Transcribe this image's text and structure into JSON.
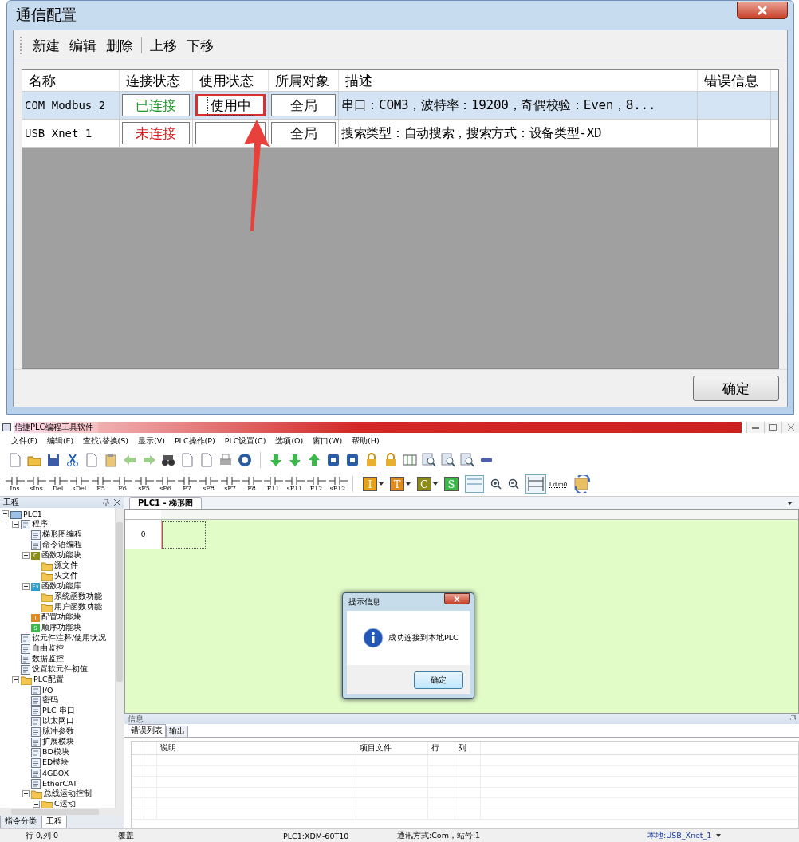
{
  "config_dialog": {
    "title": "通信配置",
    "toolbar": [
      {
        "label": "新建",
        "separator_before": false
      },
      {
        "label": "编辑",
        "separator_before": false
      },
      {
        "label": "删除",
        "separator_before": false
      },
      {
        "label": "上移",
        "separator_before": true
      },
      {
        "label": "下移",
        "separator_before": false
      }
    ],
    "columns": [
      "名称",
      "连接状态",
      "使用状态",
      "所属对象",
      "描述",
      "错误信息"
    ],
    "rows": [
      {
        "name": "COM_Modbus_2",
        "status": "已连接",
        "connected": true,
        "usage": "使用中",
        "highlighted": true,
        "scope": "全局",
        "description": "串口：COM3，波特率：19200，奇偶校验：Even，8...",
        "selected": true
      },
      {
        "name": "USB_Xnet_1",
        "status": "未连接",
        "connected": false,
        "highlighted": false,
        "scope": "全局",
        "description": "搜索类型：自动搜索，搜索方式：设备类型-XD",
        "selected": false
      }
    ],
    "ok_button": "确定"
  },
  "app": {
    "title": "信捷PLC编程工具软件",
    "menu": [
      "文件(F)",
      "编辑(E)",
      "查找\\替换(S)",
      "显示(V)",
      "PLC操作(P)",
      "PLC设置(C)",
      "选项(O)",
      "窗口(W)",
      "帮助(H)"
    ],
    "ladder_tools": [
      "Ins",
      "sIns",
      "Del",
      "sDel",
      "F5",
      "F6",
      "sF5",
      "sF6",
      "F7",
      "sF8",
      "sF7",
      "F8",
      "F11",
      "sF11",
      "F12",
      "sF12"
    ],
    "letter_tools": [
      {
        "letter": "I",
        "color": "#e6a21c"
      },
      {
        "letter": "T",
        "color": "#e08a20"
      },
      {
        "letter": "C",
        "color": "#8c8c18"
      },
      {
        "letter": "S",
        "color": "#3cb84a"
      }
    ],
    "ld_label": "Ld m0",
    "project_panel": {
      "title": "工程",
      "tree": [
        {
          "label": "PLC1",
          "kind": "plc",
          "expanded": true,
          "children": [
            {
              "label": "程序",
              "kind": "doc",
              "expanded": true,
              "children": [
                {
                  "label": "梯形图编程",
                  "kind": "doc"
                },
                {
                  "label": "命令语编程",
                  "kind": "doc"
                },
                {
                  "label": "函数功能块",
                  "kind": "badge",
                  "badge": "C",
                  "color": "#8c8c18",
                  "expanded": true,
                  "children": [
                    {
                      "label": "源文件",
                      "kind": "folder"
                    },
                    {
                      "label": "头文件",
                      "kind": "folder"
                    }
                  ]
                },
                {
                  "label": "函数功能库",
                  "kind": "badge",
                  "badge": "Ex",
                  "color": "#2a9fd0",
                  "expanded": true,
                  "children": [
                    {
                      "label": "系统函数功能",
                      "kind": "folder"
                    },
                    {
                      "label": "用户函数功能",
                      "kind": "folder"
                    }
                  ]
                },
                {
                  "label": "配置功能块",
                  "kind": "badge",
                  "badge": "T",
                  "color": "#e08a20"
                },
                {
                  "label": "顺序功能块",
                  "kind": "badge",
                  "badge": "S",
                  "color": "#3cb84a"
                }
              ]
            },
            {
              "label": "软元件注释/使用状况",
              "kind": "doc"
            },
            {
              "label": "自由监控",
              "kind": "doc"
            },
            {
              "label": "数据监控",
              "kind": "doc"
            },
            {
              "label": "设置软元件初值",
              "kind": "doc"
            },
            {
              "label": "PLC配置",
              "kind": "folder",
              "expanded": true,
              "children": [
                {
                  "label": "I/O",
                  "kind": "doc"
                },
                {
                  "label": "密码",
                  "kind": "doc"
                },
                {
                  "label": "PLC 串口",
                  "kind": "doc"
                },
                {
                  "label": "以太网口",
                  "kind": "doc"
                },
                {
                  "label": "脉冲参数",
                  "kind": "doc"
                },
                {
                  "label": "扩展模块",
                  "kind": "doc"
                },
                {
                  "label": "BD模块",
                  "kind": "doc"
                },
                {
                  "label": "ED模块",
                  "kind": "doc"
                },
                {
                  "label": "4GBOX",
                  "kind": "doc"
                },
                {
                  "label": "EtherCAT",
                  "kind": "doc"
                },
                {
                  "label": "总线运动控制",
                  "kind": "folder",
                  "expanded": true,
                  "children": [
                    {
                      "label": "C运动",
                      "kind": "folder",
                      "expanded": true
                    }
                  ]
                }
              ]
            }
          ]
        }
      ],
      "tabs": [
        {
          "label": "指令分类",
          "selected": false
        },
        {
          "label": "工程",
          "selected": true
        }
      ]
    },
    "editor": {
      "tab": "PLC1 - 梯形图",
      "rung": "0"
    },
    "message_box": {
      "title": "提示信息",
      "text": "成功连接到本地PLC",
      "ok": "确定"
    },
    "info_panel": {
      "title": "信息",
      "tabs": [
        {
          "label": "错误列表",
          "selected": true
        },
        {
          "label": "输出",
          "selected": false
        }
      ],
      "columns": [
        "说明",
        "项目文件",
        "行",
        "列"
      ]
    },
    "status_bar": {
      "position": "行 0,列 0",
      "mode": "覆盖",
      "plc": "PLC1:XDM-60T10",
      "comm": "通讯方式:Com，站号:1",
      "connection": "本地:USB_Xnet_1"
    }
  }
}
